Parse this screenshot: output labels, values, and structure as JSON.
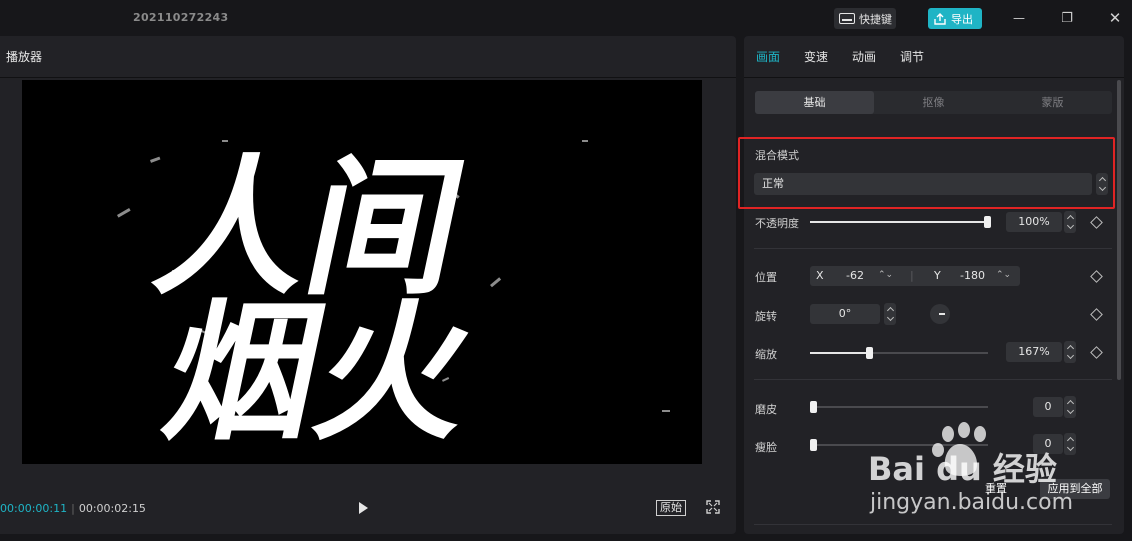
{
  "titlebar": {
    "project_title": "202110272243",
    "shortcut_label": "快捷键",
    "export_label": "导出",
    "minimize_glyph": "—",
    "maximize_glyph": "❐",
    "close_glyph": "✕"
  },
  "player": {
    "title": "播放器",
    "current_time": "00:00:00:11",
    "total_time": "00:00:02:15",
    "original_label": "原始",
    "video_text": [
      "人间",
      "烟火"
    ]
  },
  "props": {
    "tabs": [
      {
        "label": "画面",
        "active": true
      },
      {
        "label": "变速",
        "active": false
      },
      {
        "label": "动画",
        "active": false
      },
      {
        "label": "调节",
        "active": false
      }
    ],
    "subtabs": [
      {
        "label": "基础",
        "active": true
      },
      {
        "label": "抠像",
        "active": false
      },
      {
        "label": "蒙版",
        "active": false
      }
    ],
    "blend": {
      "label": "混合模式",
      "value": "正常"
    },
    "opacity": {
      "label": "不透明度",
      "value": "100%",
      "level": 1.0
    },
    "position": {
      "label": "位置",
      "x_label": "X",
      "x_value": "-62",
      "y_label": "Y",
      "y_value": "-180"
    },
    "rotation": {
      "label": "旋转",
      "value": "0°"
    },
    "scale": {
      "label": "缩放",
      "value": "167%",
      "level": 0.33
    },
    "smooth": {
      "label": "磨皮",
      "value": "0",
      "level": 0.0
    },
    "face": {
      "label": "瘦脸",
      "value": "0",
      "level": 0.0
    },
    "reset_label": "重置",
    "apply_all_label": "应用到全部"
  },
  "watermark": {
    "logo": "Bai du 经验",
    "url": "jingyan.baidu.com"
  },
  "colors": {
    "accent": "#1fb4c5",
    "highlight": "#e02424",
    "panel": "#222226",
    "background": "#17171a"
  }
}
